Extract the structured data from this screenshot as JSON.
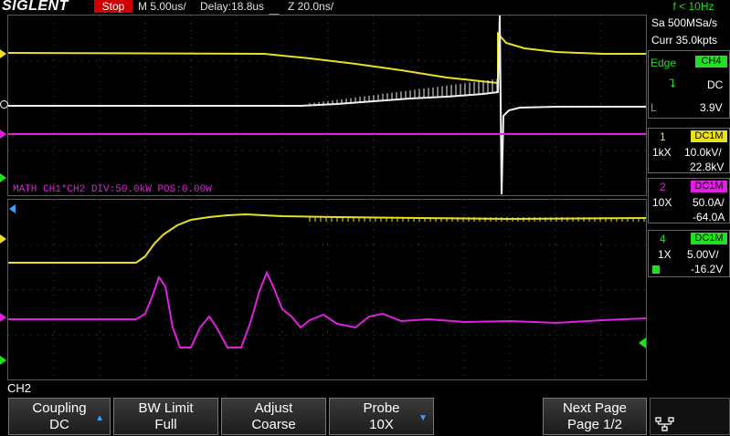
{
  "topbar": {
    "brand": "SIGLENT",
    "run_state": "Stop",
    "timebase": "M 5.00us/",
    "delay": "Delay:18.8us",
    "zoom": "Z 20.0ns/",
    "frequency": "f < 10Hz"
  },
  "acquisition": {
    "sample_rate": "Sa 500MSa/s",
    "memory": "Curr 35.0kpts"
  },
  "trigger": {
    "type": "Edge",
    "source": "CH4",
    "coupling": "DC",
    "level_label": "L",
    "level": "3.9V"
  },
  "math": {
    "label": "MATH  CH1*CH2  DIV:50.0kW  POS:0.00W"
  },
  "channels": [
    {
      "num": "1",
      "coupling": "DC1M",
      "probe": "1kX",
      "scale": "10.0kV/",
      "offset": "22.8kV",
      "color": "#e8e020"
    },
    {
      "num": "2",
      "coupling": "DC1M",
      "probe": "10X",
      "scale": "50.0A/",
      "offset": "-64.0A",
      "color": "#e020e0"
    },
    {
      "num": "4",
      "coupling": "DC1M",
      "probe": "1X",
      "scale": "5.00V/",
      "offset": "-16.2V",
      "color": "#20e020"
    }
  ],
  "menu": {
    "title": "CH2",
    "softkeys": [
      {
        "title": "Coupling",
        "value": "DC"
      },
      {
        "title": "BW Limit",
        "value": "Full"
      },
      {
        "title": "Adjust",
        "value": "Coarse"
      },
      {
        "title": "Probe",
        "value": "10X"
      },
      {
        "title": "Next Page",
        "value": "Page 1/2"
      }
    ]
  },
  "colors": {
    "ch1": "#e8e020",
    "ch2": "#e020e0",
    "ch4": "#20e020",
    "white": "#f0f0f0",
    "accent": "#3aa0ff",
    "stop": "#d00000"
  }
}
